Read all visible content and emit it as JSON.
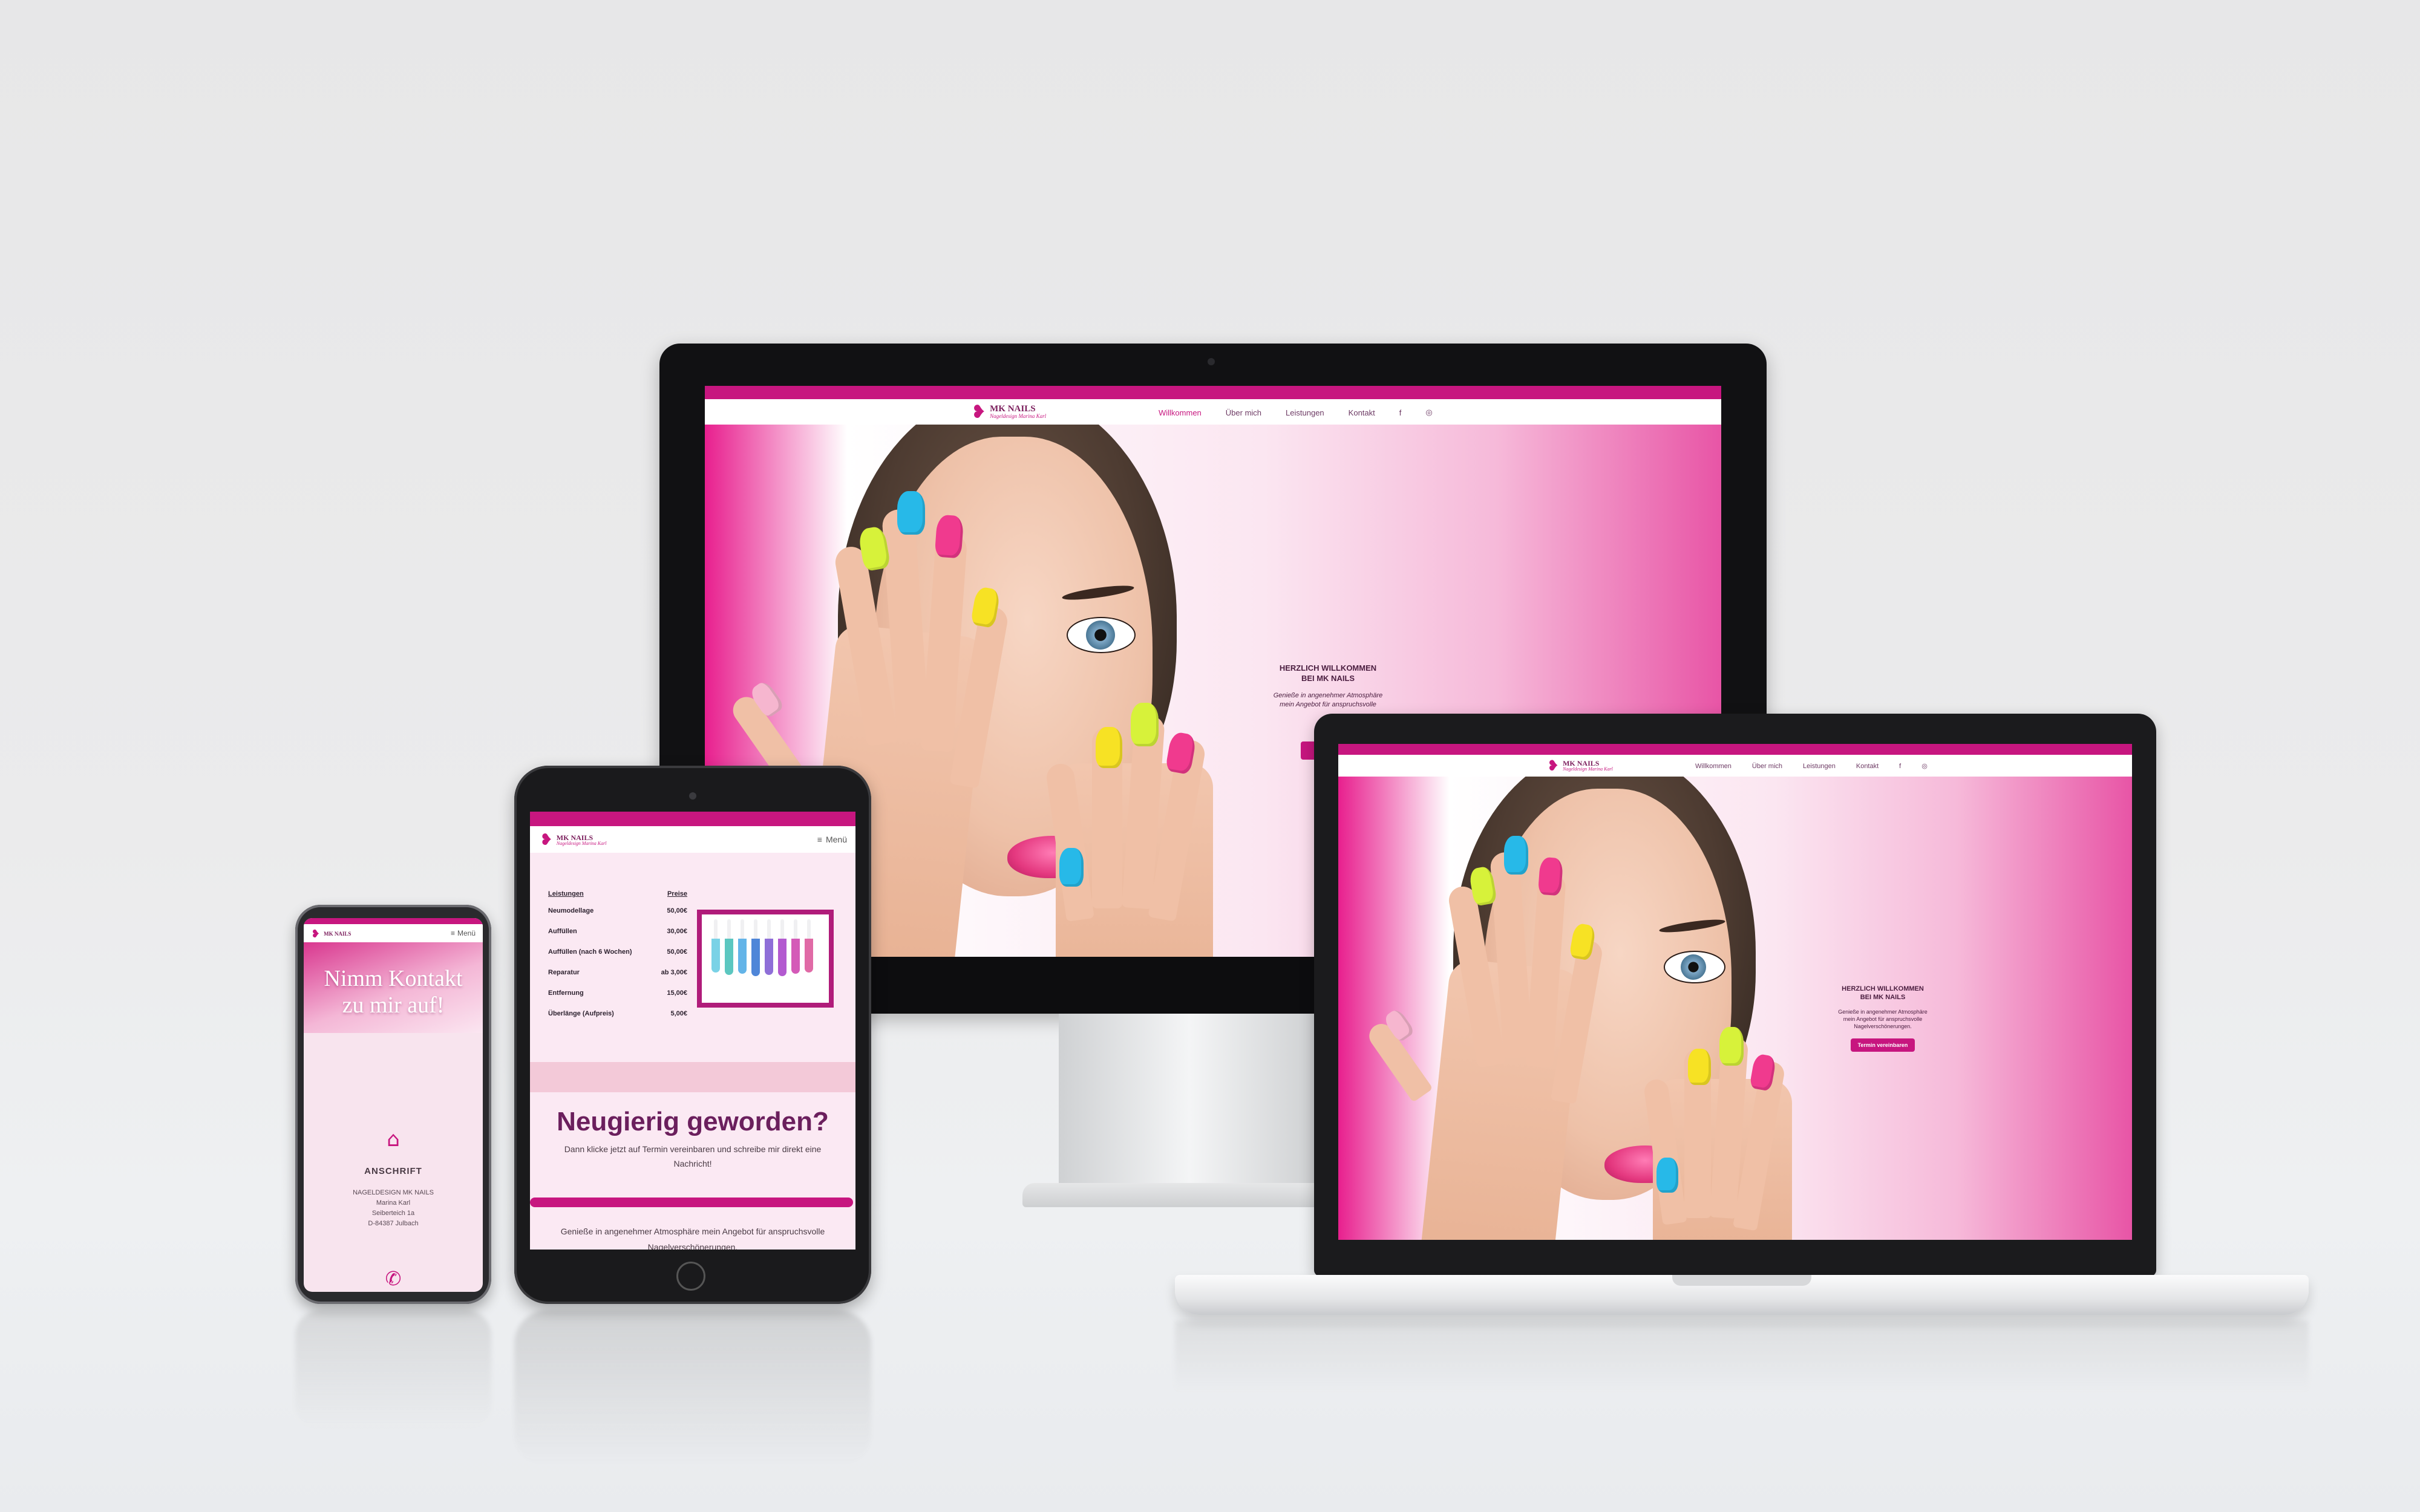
{
  "site": {
    "logo_title": "MK NAILS",
    "logo_subtitle": "Nageldesign Marina Karl",
    "nav": [
      "Willkommen",
      "Über mich",
      "Leistungen",
      "Kontakt"
    ],
    "social": [
      "f",
      "◎"
    ],
    "hero_heading_line1": "HERZLICH WILLKOMMEN",
    "hero_heading_line2": "BEI MK NAILS",
    "hero_text_line1": "Genieße in angenehmer Atmosphäre",
    "hero_text_line2": "mein Angebot für anspruchsvolle",
    "hero_text_line3": "Nagelverschönerungen.",
    "hero_button": "Termin vereinbaren",
    "menu_label": "Menü"
  },
  "tablet": {
    "header_left": "Leistungen",
    "header_right": "Preise",
    "prices": [
      {
        "service": "Neumodellage",
        "price": "50,00€"
      },
      {
        "service": "Auffüllen",
        "price": "30,00€"
      },
      {
        "service": "Auffüllen (nach 6 Wochen)",
        "price": "50,00€"
      },
      {
        "service": "Reparatur",
        "price": "ab 3,00€"
      },
      {
        "service": "Entfernung",
        "price": "15,00€"
      },
      {
        "service": "Überlänge (Aufpreis)",
        "price": "5,00€"
      }
    ],
    "cta_heading": "Neugierig geworden?",
    "cta_text_line1": "Dann klicke jetzt auf Termin vereinbaren und schreibe mir direkt eine",
    "cta_text_line2": "Nachricht!",
    "footer_line1": "Genieße in angenehmer Atmosphäre mein Angebot für anspruchsvolle",
    "footer_line2": "Nagelverschönerungen."
  },
  "phone": {
    "banner_line1": "Nimm Kontakt",
    "banner_line2": "zu mir auf!",
    "address_title": "ANSCHRIFT",
    "address_lines": [
      "NAGELDESIGN MK NAILS",
      "Marina Karl",
      "Seiberteich 1a",
      "D-84387 Julbach"
    ]
  },
  "colors": {
    "brand": "#c7167f",
    "brand_dark": "#6b1f5d",
    "nail_colors": [
      "#d7f23a",
      "#27b9e8",
      "#f03a8e",
      "#f7e224",
      "#f7e224",
      "#f7e224",
      "#f03a8e",
      "#27b9e8"
    ]
  },
  "icons": [
    "heart-logo-icon",
    "menu-icon",
    "facebook-icon",
    "instagram-icon",
    "home-icon",
    "phone-icon"
  ]
}
